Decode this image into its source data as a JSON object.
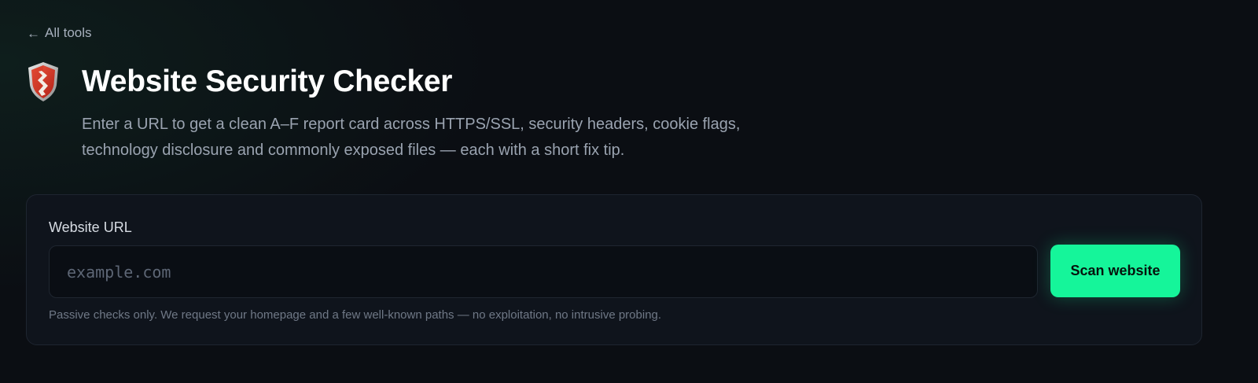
{
  "nav": {
    "back_label": "All tools"
  },
  "header": {
    "title": "Website Security Checker",
    "description": "Enter a URL to get a clean A–F report card across HTTPS/SSL, security headers, cookie flags, technology disclosure and commonly exposed files — each with a short fix tip."
  },
  "form": {
    "label": "Website URL",
    "input_value": "",
    "input_placeholder": "example.com",
    "button_label": "Scan website",
    "hint": "Passive checks only. We request your homepage and a few well-known paths — no exploitation, no intrusive probing."
  },
  "icons": {
    "back": "arrow-left-icon",
    "logo": "shield-icon"
  },
  "colors": {
    "accent": "#15f59a",
    "background": "#0b0e13",
    "card": "#0f141c"
  }
}
